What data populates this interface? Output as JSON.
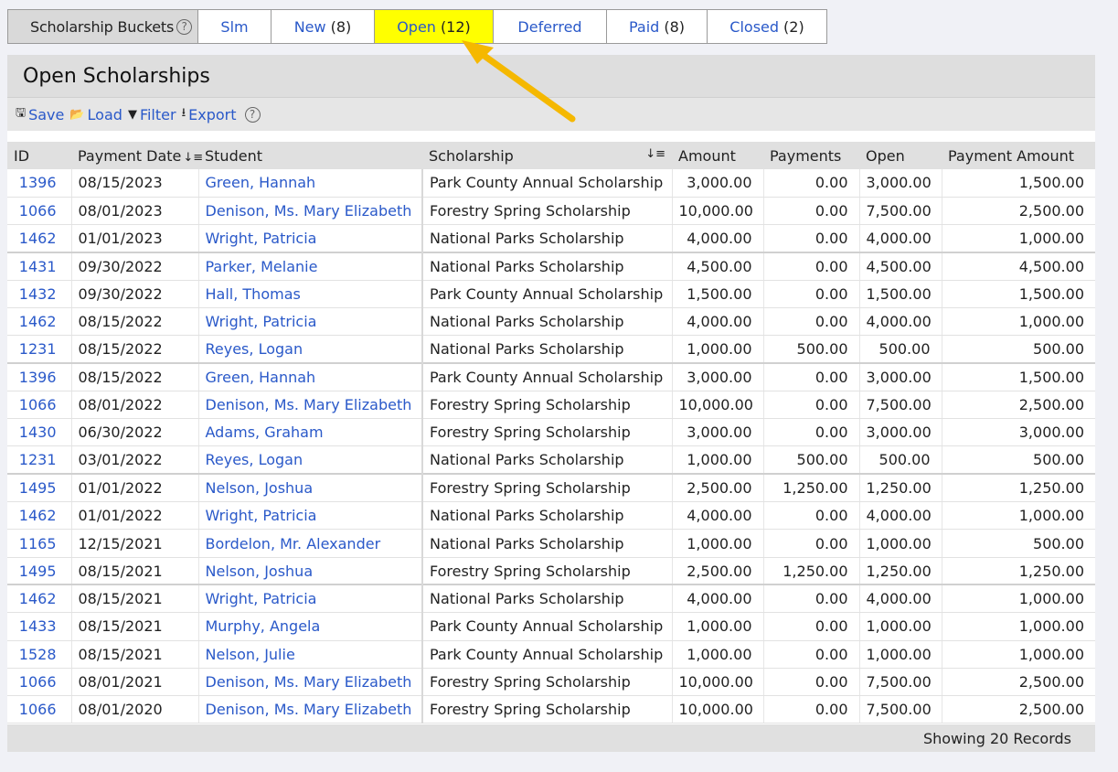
{
  "buckets": {
    "label": "Scholarship Buckets",
    "help": "?",
    "tabs": [
      {
        "label": "Slm",
        "count": ""
      },
      {
        "label": "New",
        "count": "(8)"
      },
      {
        "label": "Open",
        "count": "(12)"
      },
      {
        "label": "Deferred",
        "count": ""
      },
      {
        "label": "Paid",
        "count": "(8)"
      },
      {
        "label": "Closed",
        "count": "(2)"
      }
    ],
    "active_color": "#ffff00"
  },
  "panel": {
    "title": "Open Scholarships",
    "toolbar": {
      "save": "Save",
      "load": "Load",
      "filter": "Filter",
      "export": "Export",
      "help": "?"
    },
    "columns": {
      "id": "ID",
      "payment_date": "Payment Date",
      "student": "Student",
      "scholarship": "Scholarship",
      "amount": "Amount",
      "payments": "Payments",
      "open": "Open",
      "payment_amount": "Payment Amount"
    },
    "rows": [
      {
        "id": "1396",
        "date": "08/15/2023",
        "student": "Green, Hannah",
        "scholarship": "Park County Annual Scholarship",
        "amount": "3,000.00",
        "payments": "0.00",
        "open": "3,000.00",
        "payment_amount": "1,500.00"
      },
      {
        "id": "1066",
        "date": "08/01/2023",
        "student": "Denison, Ms. Mary Elizabeth",
        "scholarship": "Forestry Spring Scholarship",
        "amount": "10,000.00",
        "payments": "0.00",
        "open": "7,500.00",
        "payment_amount": "2,500.00"
      },
      {
        "id": "1462",
        "date": "01/01/2023",
        "student": "Wright, Patricia",
        "scholarship": "National Parks Scholarship",
        "amount": "4,000.00",
        "payments": "0.00",
        "open": "4,000.00",
        "payment_amount": "1,000.00"
      },
      {
        "id": "1431",
        "date": "09/30/2022",
        "student": "Parker, Melanie",
        "scholarship": "National Parks Scholarship",
        "amount": "4,500.00",
        "payments": "0.00",
        "open": "4,500.00",
        "payment_amount": "4,500.00"
      },
      {
        "id": "1432",
        "date": "09/30/2022",
        "student": "Hall, Thomas",
        "scholarship": "Park County Annual Scholarship",
        "amount": "1,500.00",
        "payments": "0.00",
        "open": "1,500.00",
        "payment_amount": "1,500.00"
      },
      {
        "id": "1462",
        "date": "08/15/2022",
        "student": "Wright, Patricia",
        "scholarship": "National Parks Scholarship",
        "amount": "4,000.00",
        "payments": "0.00",
        "open": "4,000.00",
        "payment_amount": "1,000.00"
      },
      {
        "id": "1231",
        "date": "08/15/2022",
        "student": "Reyes, Logan",
        "scholarship": "National Parks Scholarship",
        "amount": "1,000.00",
        "payments": "500.00",
        "open": "500.00",
        "payment_amount": "500.00"
      },
      {
        "id": "1396",
        "date": "08/15/2022",
        "student": "Green, Hannah",
        "scholarship": "Park County Annual Scholarship",
        "amount": "3,000.00",
        "payments": "0.00",
        "open": "3,000.00",
        "payment_amount": "1,500.00"
      },
      {
        "id": "1066",
        "date": "08/01/2022",
        "student": "Denison, Ms. Mary Elizabeth",
        "scholarship": "Forestry Spring Scholarship",
        "amount": "10,000.00",
        "payments": "0.00",
        "open": "7,500.00",
        "payment_amount": "2,500.00"
      },
      {
        "id": "1430",
        "date": "06/30/2022",
        "student": "Adams, Graham",
        "scholarship": "Forestry Spring Scholarship",
        "amount": "3,000.00",
        "payments": "0.00",
        "open": "3,000.00",
        "payment_amount": "3,000.00"
      },
      {
        "id": "1231",
        "date": "03/01/2022",
        "student": "Reyes, Logan",
        "scholarship": "National Parks Scholarship",
        "amount": "1,000.00",
        "payments": "500.00",
        "open": "500.00",
        "payment_amount": "500.00"
      },
      {
        "id": "1495",
        "date": "01/01/2022",
        "student": "Nelson, Joshua",
        "scholarship": "Forestry Spring Scholarship",
        "amount": "2,500.00",
        "payments": "1,250.00",
        "open": "1,250.00",
        "payment_amount": "1,250.00"
      },
      {
        "id": "1462",
        "date": "01/01/2022",
        "student": "Wright, Patricia",
        "scholarship": "National Parks Scholarship",
        "amount": "4,000.00",
        "payments": "0.00",
        "open": "4,000.00",
        "payment_amount": "1,000.00"
      },
      {
        "id": "1165",
        "date": "12/15/2021",
        "student": "Bordelon, Mr. Alexander",
        "scholarship": "National Parks Scholarship",
        "amount": "1,000.00",
        "payments": "0.00",
        "open": "1,000.00",
        "payment_amount": "500.00"
      },
      {
        "id": "1495",
        "date": "08/15/2021",
        "student": "Nelson, Joshua",
        "scholarship": "Forestry Spring Scholarship",
        "amount": "2,500.00",
        "payments": "1,250.00",
        "open": "1,250.00",
        "payment_amount": "1,250.00"
      },
      {
        "id": "1462",
        "date": "08/15/2021",
        "student": "Wright, Patricia",
        "scholarship": "National Parks Scholarship",
        "amount": "4,000.00",
        "payments": "0.00",
        "open": "4,000.00",
        "payment_amount": "1,000.00"
      },
      {
        "id": "1433",
        "date": "08/15/2021",
        "student": "Murphy, Angela",
        "scholarship": "Park County Annual Scholarship",
        "amount": "1,000.00",
        "payments": "0.00",
        "open": "1,000.00",
        "payment_amount": "1,000.00"
      },
      {
        "id": "1528",
        "date": "08/15/2021",
        "student": "Nelson, Julie",
        "scholarship": "Park County Annual Scholarship",
        "amount": "1,000.00",
        "payments": "0.00",
        "open": "1,000.00",
        "payment_amount": "1,000.00"
      },
      {
        "id": "1066",
        "date": "08/01/2021",
        "student": "Denison, Ms. Mary Elizabeth",
        "scholarship": "Forestry Spring Scholarship",
        "amount": "10,000.00",
        "payments": "0.00",
        "open": "7,500.00",
        "payment_amount": "2,500.00"
      },
      {
        "id": "1066",
        "date": "08/01/2020",
        "student": "Denison, Ms. Mary Elizabeth",
        "scholarship": "Forestry Spring Scholarship",
        "amount": "10,000.00",
        "payments": "0.00",
        "open": "7,500.00",
        "payment_amount": "2,500.00"
      }
    ],
    "footer": "Showing 20 Records"
  },
  "colors": {
    "link": "#2a59c9",
    "arrow": "#f5b800",
    "header_bg": "#dedede"
  }
}
